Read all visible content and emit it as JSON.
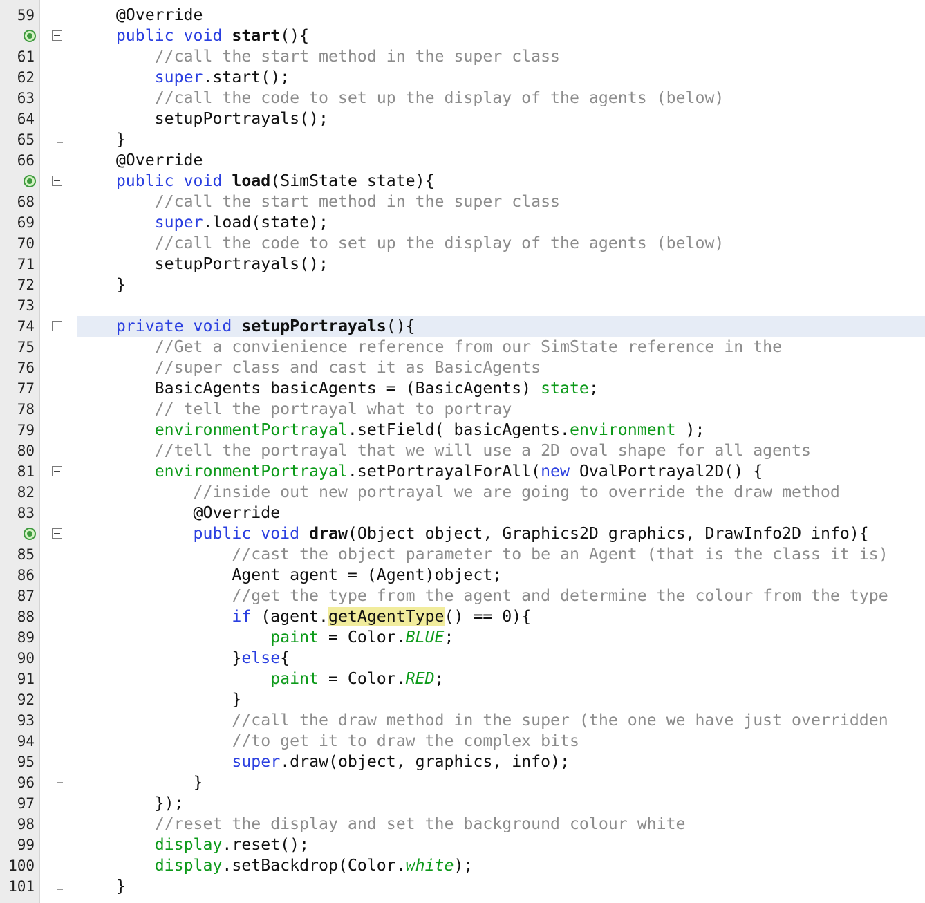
{
  "editor": {
    "highlighted_line": 74,
    "lines": [
      {
        "n": "59",
        "segs": [
          [
            "",
            "    @Override"
          ]
        ]
      },
      {
        "n": "",
        "override": true,
        "fold": "start",
        "segs": [
          [
            "",
            "    "
          ],
          [
            "kw",
            "public"
          ],
          [
            "",
            " "
          ],
          [
            "kw",
            "void"
          ],
          [
            "",
            " "
          ],
          [
            "b",
            "start"
          ],
          [
            "",
            "(){"
          ]
        ]
      },
      {
        "n": "61",
        "segs": [
          [
            "",
            "        "
          ],
          [
            "cm",
            "//call the start method in the super class"
          ]
        ]
      },
      {
        "n": "62",
        "segs": [
          [
            "",
            "        "
          ],
          [
            "kw",
            "super"
          ],
          [
            "",
            ".start();"
          ]
        ]
      },
      {
        "n": "63",
        "segs": [
          [
            "",
            "        "
          ],
          [
            "cm",
            "//call the code to set up the display of the agents (below)"
          ]
        ]
      },
      {
        "n": "64",
        "segs": [
          [
            "",
            "        setupPortrayals();"
          ]
        ]
      },
      {
        "n": "65",
        "fold": "end",
        "segs": [
          [
            "",
            "    }"
          ]
        ]
      },
      {
        "n": "66",
        "segs": [
          [
            "",
            "    @Override"
          ]
        ]
      },
      {
        "n": "",
        "override": true,
        "fold": "start",
        "segs": [
          [
            "",
            "    "
          ],
          [
            "kw",
            "public"
          ],
          [
            "",
            " "
          ],
          [
            "kw",
            "void"
          ],
          [
            "",
            " "
          ],
          [
            "b",
            "load"
          ],
          [
            "",
            "(SimState state){"
          ]
        ]
      },
      {
        "n": "68",
        "segs": [
          [
            "",
            "        "
          ],
          [
            "cm",
            "//call the start method in the super class"
          ]
        ]
      },
      {
        "n": "69",
        "segs": [
          [
            "",
            "        "
          ],
          [
            "kw",
            "super"
          ],
          [
            "",
            ".load(state);"
          ]
        ]
      },
      {
        "n": "70",
        "segs": [
          [
            "",
            "        "
          ],
          [
            "cm",
            "//call the code to set up the display of the agents (below)"
          ]
        ]
      },
      {
        "n": "71",
        "segs": [
          [
            "",
            "        setupPortrayals();"
          ]
        ]
      },
      {
        "n": "72",
        "fold": "end",
        "segs": [
          [
            "",
            "    }"
          ]
        ]
      },
      {
        "n": "73",
        "segs": []
      },
      {
        "n": "74",
        "fold": "start",
        "segs": [
          [
            "",
            "    "
          ],
          [
            "kw",
            "private"
          ],
          [
            "",
            " "
          ],
          [
            "kw",
            "void"
          ],
          [
            "",
            " "
          ],
          [
            "b",
            "setupPortrayals"
          ],
          [
            "",
            "(){"
          ]
        ]
      },
      {
        "n": "75",
        "segs": [
          [
            "",
            "        "
          ],
          [
            "cm",
            "//Get a convienience reference from our SimState reference in the"
          ]
        ]
      },
      {
        "n": "76",
        "segs": [
          [
            "",
            "        "
          ],
          [
            "cm",
            "//super class and cast it as BasicAgents"
          ]
        ]
      },
      {
        "n": "77",
        "segs": [
          [
            "",
            "        BasicAgents basicAgents = (BasicAgents) "
          ],
          [
            "fld",
            "state"
          ],
          [
            "",
            ";"
          ]
        ]
      },
      {
        "n": "78",
        "segs": [
          [
            "",
            "        "
          ],
          [
            "cm",
            "// tell the portrayal what to portray"
          ]
        ]
      },
      {
        "n": "79",
        "segs": [
          [
            "",
            "        "
          ],
          [
            "fld",
            "environmentPortrayal"
          ],
          [
            "",
            ".setField( basicAgents."
          ],
          [
            "fld",
            "environment"
          ],
          [
            "",
            " );"
          ]
        ]
      },
      {
        "n": "80",
        "segs": [
          [
            "",
            "        "
          ],
          [
            "cm",
            "//tell the portrayal that we will use a 2D oval shape for all agents"
          ]
        ]
      },
      {
        "n": "81",
        "fold": "start",
        "segs": [
          [
            "",
            "        "
          ],
          [
            "fld",
            "environmentPortrayal"
          ],
          [
            "",
            ".setPortrayalForAll("
          ],
          [
            "kw",
            "new"
          ],
          [
            "",
            " OvalPortrayal2D() {"
          ]
        ]
      },
      {
        "n": "82",
        "segs": [
          [
            "",
            "            "
          ],
          [
            "cm",
            "//inside out new portrayal we are going to override the draw method"
          ]
        ]
      },
      {
        "n": "83",
        "segs": [
          [
            "",
            "            @Override"
          ]
        ]
      },
      {
        "n": "",
        "override": true,
        "fold": "start",
        "segs": [
          [
            "",
            "            "
          ],
          [
            "kw",
            "public"
          ],
          [
            "",
            " "
          ],
          [
            "kw",
            "void"
          ],
          [
            "",
            " "
          ],
          [
            "b",
            "draw"
          ],
          [
            "",
            "(Object object, Graphics2D graphics, DrawInfo2D info){"
          ]
        ]
      },
      {
        "n": "85",
        "segs": [
          [
            "",
            "                "
          ],
          [
            "cm",
            "//cast the object parameter to be an Agent (that is the class it is)"
          ]
        ]
      },
      {
        "n": "86",
        "segs": [
          [
            "",
            "                Agent agent = (Agent)object;"
          ]
        ]
      },
      {
        "n": "87",
        "segs": [
          [
            "",
            "                "
          ],
          [
            "cm",
            "//get the type from the agent and determine the colour from the type"
          ]
        ]
      },
      {
        "n": "88",
        "segs": [
          [
            "",
            "                "
          ],
          [
            "kw",
            "if"
          ],
          [
            "",
            " (agent."
          ],
          [
            "mark",
            "getAgentType"
          ],
          [
            "",
            "() == 0){"
          ]
        ]
      },
      {
        "n": "89",
        "segs": [
          [
            "",
            "                    "
          ],
          [
            "fld",
            "paint"
          ],
          [
            "",
            " = Color."
          ],
          [
            "st",
            "BLUE"
          ],
          [
            "",
            ";"
          ]
        ]
      },
      {
        "n": "90",
        "segs": [
          [
            "",
            "                }"
          ],
          [
            "kw",
            "else"
          ],
          [
            "",
            "{"
          ]
        ]
      },
      {
        "n": "91",
        "segs": [
          [
            "",
            "                    "
          ],
          [
            "fld",
            "paint"
          ],
          [
            "",
            " = Color."
          ],
          [
            "st",
            "RED"
          ],
          [
            "",
            ";"
          ]
        ]
      },
      {
        "n": "92",
        "segs": [
          [
            "",
            "                }"
          ]
        ]
      },
      {
        "n": "93",
        "segs": [
          [
            "",
            "                "
          ],
          [
            "cm",
            "//call the draw method in the super (the one we have just overridden"
          ]
        ]
      },
      {
        "n": "94",
        "segs": [
          [
            "",
            "                "
          ],
          [
            "cm",
            "//to get it to draw the complex bits"
          ]
        ]
      },
      {
        "n": "95",
        "segs": [
          [
            "",
            "                "
          ],
          [
            "kw",
            "super"
          ],
          [
            "",
            ".draw(object, graphics, info);"
          ]
        ]
      },
      {
        "n": "96",
        "fold": "tick",
        "segs": [
          [
            "",
            "            }"
          ]
        ]
      },
      {
        "n": "97",
        "fold": "tick",
        "segs": [
          [
            "",
            "        });"
          ]
        ]
      },
      {
        "n": "98",
        "segs": [
          [
            "",
            "        "
          ],
          [
            "cm",
            "//reset the display and set the background colour white"
          ]
        ]
      },
      {
        "n": "99",
        "segs": [
          [
            "",
            "        "
          ],
          [
            "fld",
            "display"
          ],
          [
            "",
            ".reset();"
          ]
        ]
      },
      {
        "n": "100",
        "segs": [
          [
            "",
            "        "
          ],
          [
            "fld",
            "display"
          ],
          [
            "",
            ".setBackdrop(Color."
          ],
          [
            "st",
            "white"
          ],
          [
            "",
            ");"
          ]
        ]
      },
      {
        "n": "101",
        "fold": "end",
        "segs": [
          [
            "",
            "    }"
          ]
        ]
      }
    ]
  }
}
